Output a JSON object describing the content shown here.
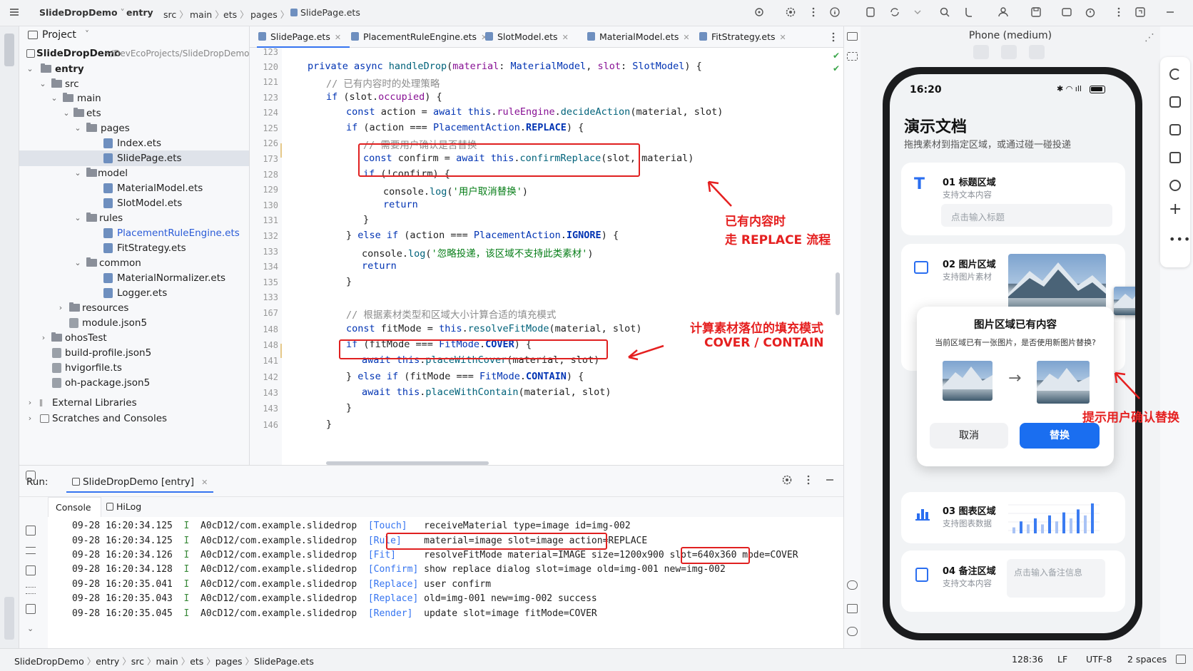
{
  "topbar": {
    "breadcrumb": [
      "SlideDropDemo",
      "entry",
      "src",
      "main",
      "ets",
      "pages",
      "SlidePage.ets"
    ]
  },
  "project": {
    "title": "Project",
    "root_name": "SlideDropDemo",
    "root_path": "~/DevEcoProjects/SlideDropDemo",
    "items": [
      {
        "label": "entry"
      },
      {
        "label": "src"
      },
      {
        "label": "main"
      },
      {
        "label": "ets"
      },
      {
        "label": "pages"
      },
      {
        "label": "Index.ets"
      },
      {
        "label": "SlidePage.ets"
      },
      {
        "label": "model"
      },
      {
        "label": "MaterialModel.ets"
      },
      {
        "label": "SlotModel.ets"
      },
      {
        "label": "rules"
      },
      {
        "label": "PlacementRuleEngine.ets"
      },
      {
        "label": "FitStrategy.ets"
      },
      {
        "label": "common"
      },
      {
        "label": "MaterialNormalizer.ets"
      },
      {
        "label": "Logger.ets"
      },
      {
        "label": "resources"
      },
      {
        "label": "module.json5"
      },
      {
        "label": "ohosTest"
      },
      {
        "label": "build-profile.json5"
      },
      {
        "label": "hvigorfile.ts"
      },
      {
        "label": "oh-package.json5"
      },
      {
        "label": "External Libraries"
      },
      {
        "label": "Scratches and Consoles"
      }
    ]
  },
  "tabs": [
    "SlidePage.ets",
    "PlacementRuleEngine.ets",
    "SlotModel.ets",
    "MaterialModel.ets",
    "FitStrategy.ets"
  ],
  "editor": {
    "line_numbers": [
      "123",
      "120",
      "121",
      "123",
      "124",
      "125",
      "126",
      "173",
      "128",
      "129",
      "130",
      "131",
      "132",
      "133",
      "134",
      "135",
      "133",
      "167",
      "148",
      "148",
      "141",
      "142",
      "143",
      "143",
      "146"
    ],
    "lines": [
      "",
      "  private async handleDrop(material: MaterialModel, slot: SlotModel) {",
      "    // 已有内容时的处理策略",
      "    if (slot.occupied) {",
      "      const action = await this.ruleEngine.decideAction(material, slot)",
      "      if (action === PlacementAction.REPLACE) {",
      "        // 需要用户确认是否替换",
      "        const confirm = await this.confirmReplace(slot, material)",
      "        if (!confirm) {",
      "          console.log('用户取消替换')",
      "          return",
      "        }",
      "      } else if (action === PlacementAction.IGNORE) {",
      "        console.log('忽略投递，该区域不支持此类素材')",
      "        return",
      "      }",
      "",
      "      // 根据素材类型和区域大小计算合适的填充模式",
      "      const fitMode = this.resolveFitMode(material, slot)",
      "      if (fitMode === FitMode.COVER) {",
      "        await this.placeWithCover(material, slot)",
      "      } else if (fitMode === FitMode.CONTAIN) {",
      "        await this.placeWithContain(material, slot)",
      "      }",
      "    }"
    ]
  },
  "annotations": {
    "a1_line1": "已有内容时",
    "a1_line2": "走 REPLACE 流程",
    "a2_line1": "计算素材落位的填充模式",
    "a2_line2": "COVER / CONTAIN",
    "a3": "提示用户确认替换"
  },
  "run": {
    "label": "Run:",
    "config": "SlideDropDemo [entry]",
    "tab_console": "Console",
    "tab_hilog": "HiLog",
    "logs": [
      {
        "time": "09-28 16:20:34.125",
        "lvl": "I",
        "src": "A0cD12/com.example.slidedrop",
        "tag": "[Touch]",
        "msg": "receiveMaterial type=image id=img-002"
      },
      {
        "time": "09-28 16:20:34.125",
        "lvl": "I",
        "src": "A0cD12/com.example.slidedrop",
        "tag": "[Rule]",
        "msg": "material=image slot=image action=REPLACE"
      },
      {
        "time": "09-28 16:20:34.126",
        "lvl": "I",
        "src": "A0cD12/com.example.slidedrop",
        "tag": "[Fit]",
        "msg": "resolveFitMode material=IMAGE size=1200x900 slot=640x360",
        "msg2": "mode=COVER"
      },
      {
        "time": "09-28 16:20:34.128",
        "lvl": "I",
        "src": "A0cD12/com.example.slidedrop",
        "tag": "[Confirm]",
        "msg": "show replace dialog slot=image old=img-001 new=img-002"
      },
      {
        "time": "09-28 16:20:35.041",
        "lvl": "I",
        "src": "A0cD12/com.example.slidedrop",
        "tag": "[Replace]",
        "msg": "user confirm"
      },
      {
        "time": "09-28 16:20:35.043",
        "lvl": "I",
        "src": "A0cD12/com.example.slidedrop",
        "tag": "[Replace]",
        "msg": "old=img-001 new=img-002 success"
      },
      {
        "time": "09-28 16:20:35.045",
        "lvl": "I",
        "src": "A0cD12/com.example.slidedrop",
        "tag": "[Render]",
        "msg": "update slot=image fitMode=COVER"
      }
    ]
  },
  "preview": {
    "device": "Phone (medium)",
    "time": "16:20",
    "app_title": "演示文档",
    "app_subtitle": "拖拽素材到指定区域，或通过碰一碰投递",
    "cards": [
      {
        "title": "01 标题区域",
        "sub": "支持文本内容",
        "placeholder": "点击输入标题"
      },
      {
        "title": "02 图片区域",
        "sub": "支持图片素材"
      },
      {
        "title": "03 图表区域",
        "sub": "支持图表数据"
      },
      {
        "title": "04 备注区域",
        "sub": "支持文本内容",
        "placeholder": "点击输入备注信息"
      }
    ],
    "dialog": {
      "title": "图片区域已有内容",
      "message": "当前区域已有一张图片，是否使用新图片替换?",
      "cancel": "取消",
      "replace": "替换"
    },
    "bar_chart_values": [
      2,
      4,
      3,
      5,
      3,
      6,
      4,
      7,
      5,
      8,
      6,
      10
    ]
  },
  "status": {
    "breadcrumb": [
      "SlideDropDemo",
      "entry",
      "src",
      "main",
      "ets",
      "pages",
      "SlidePage.ets"
    ],
    "position": "128:36",
    "line_ending": "LF",
    "encoding": "UTF-8",
    "indent": "2 spaces"
  },
  "colors": {
    "accent": "#3574f0",
    "annotation_red": "#e52020",
    "button_blue": "#1a6ef0"
  }
}
